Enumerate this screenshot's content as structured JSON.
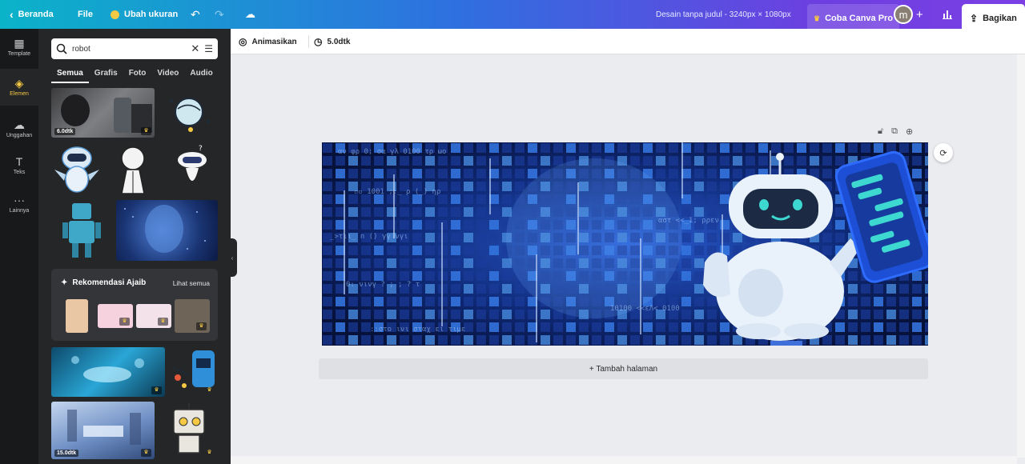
{
  "topbar": {
    "home_label": "Beranda",
    "file_label": "File",
    "resize_label": "Ubah ukuran",
    "doc_title": "Desain tanpa judul - 3240px × 1080px",
    "pro_label": "Coba Canva Pro",
    "avatar_letter": "m",
    "share_label": "Bagikan"
  },
  "rail": {
    "items": [
      {
        "label": "Template"
      },
      {
        "label": "Elemen"
      },
      {
        "label": "Unggahan"
      },
      {
        "label": "Teks"
      },
      {
        "label": "Lainnya"
      }
    ]
  },
  "panel": {
    "search_value": "robot",
    "tabs": [
      "Semua",
      "Grafis",
      "Foto",
      "Video",
      "Audio"
    ],
    "badges": {
      "video1": "6.0dtk",
      "video2": "15.0dtk"
    },
    "reco_title": "Rekomendasi Ajaib",
    "reco_link": "Lihat semua"
  },
  "toolbar": {
    "animate_label": "Animasikan",
    "duration_label": "5.0dtk"
  },
  "main": {
    "add_page_label": "+ Tambah halaman"
  },
  "colors": {
    "accent_yellow": "#f6c945",
    "panel_bg": "#252627",
    "rail_bg": "#18191b"
  }
}
